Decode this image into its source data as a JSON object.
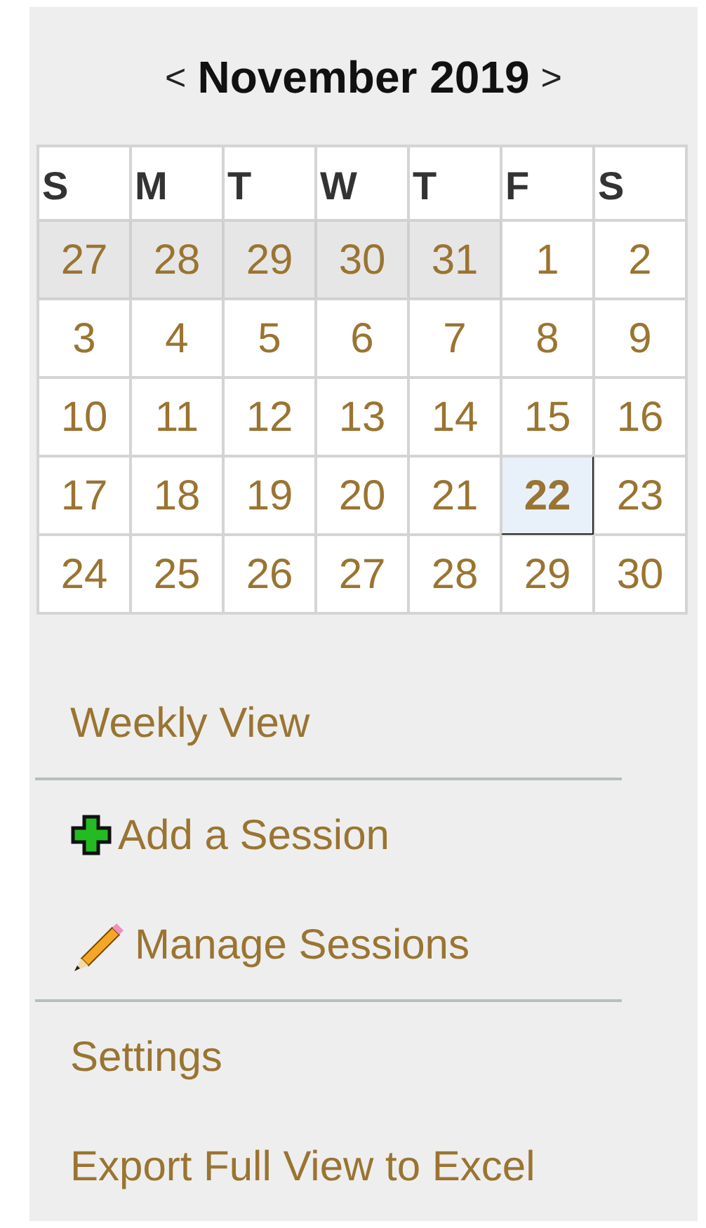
{
  "calendar": {
    "prev": "<",
    "month": "November 2019",
    "next": ">",
    "weekdays": [
      "S",
      "M",
      "T",
      "W",
      "T",
      "F",
      "S"
    ],
    "days": [
      {
        "label": "27",
        "other_month": true,
        "selected": false
      },
      {
        "label": "28",
        "other_month": true,
        "selected": false
      },
      {
        "label": "29",
        "other_month": true,
        "selected": false
      },
      {
        "label": "30",
        "other_month": true,
        "selected": false
      },
      {
        "label": "31",
        "other_month": true,
        "selected": false
      },
      {
        "label": "1",
        "other_month": false,
        "selected": false
      },
      {
        "label": "2",
        "other_month": false,
        "selected": false
      },
      {
        "label": "3",
        "other_month": false,
        "selected": false
      },
      {
        "label": "4",
        "other_month": false,
        "selected": false
      },
      {
        "label": "5",
        "other_month": false,
        "selected": false
      },
      {
        "label": "6",
        "other_month": false,
        "selected": false
      },
      {
        "label": "7",
        "other_month": false,
        "selected": false
      },
      {
        "label": "8",
        "other_month": false,
        "selected": false
      },
      {
        "label": "9",
        "other_month": false,
        "selected": false
      },
      {
        "label": "10",
        "other_month": false,
        "selected": false
      },
      {
        "label": "11",
        "other_month": false,
        "selected": false
      },
      {
        "label": "12",
        "other_month": false,
        "selected": false
      },
      {
        "label": "13",
        "other_month": false,
        "selected": false
      },
      {
        "label": "14",
        "other_month": false,
        "selected": false
      },
      {
        "label": "15",
        "other_month": false,
        "selected": false
      },
      {
        "label": "16",
        "other_month": false,
        "selected": false
      },
      {
        "label": "17",
        "other_month": false,
        "selected": false
      },
      {
        "label": "18",
        "other_month": false,
        "selected": false
      },
      {
        "label": "19",
        "other_month": false,
        "selected": false
      },
      {
        "label": "20",
        "other_month": false,
        "selected": false
      },
      {
        "label": "21",
        "other_month": false,
        "selected": false
      },
      {
        "label": "22",
        "other_month": false,
        "selected": true
      },
      {
        "label": "23",
        "other_month": false,
        "selected": false
      },
      {
        "label": "24",
        "other_month": false,
        "selected": false
      },
      {
        "label": "25",
        "other_month": false,
        "selected": false
      },
      {
        "label": "26",
        "other_month": false,
        "selected": false
      },
      {
        "label": "27",
        "other_month": false,
        "selected": false
      },
      {
        "label": "28",
        "other_month": false,
        "selected": false
      },
      {
        "label": "29",
        "other_month": false,
        "selected": false
      },
      {
        "label": "30",
        "other_month": false,
        "selected": false
      }
    ]
  },
  "menu": [
    {
      "label": "Weekly View",
      "kind": "plain",
      "divider_after": true
    },
    {
      "label": "Add a Session",
      "kind": "add",
      "divider_after": false
    },
    {
      "label": "Manage Sessions",
      "kind": "edit",
      "divider_after": true
    },
    {
      "label": "Settings",
      "kind": "plain",
      "divider_after": false
    },
    {
      "label": "Export Full View to Excel",
      "kind": "plain",
      "divider_after": false
    }
  ]
}
